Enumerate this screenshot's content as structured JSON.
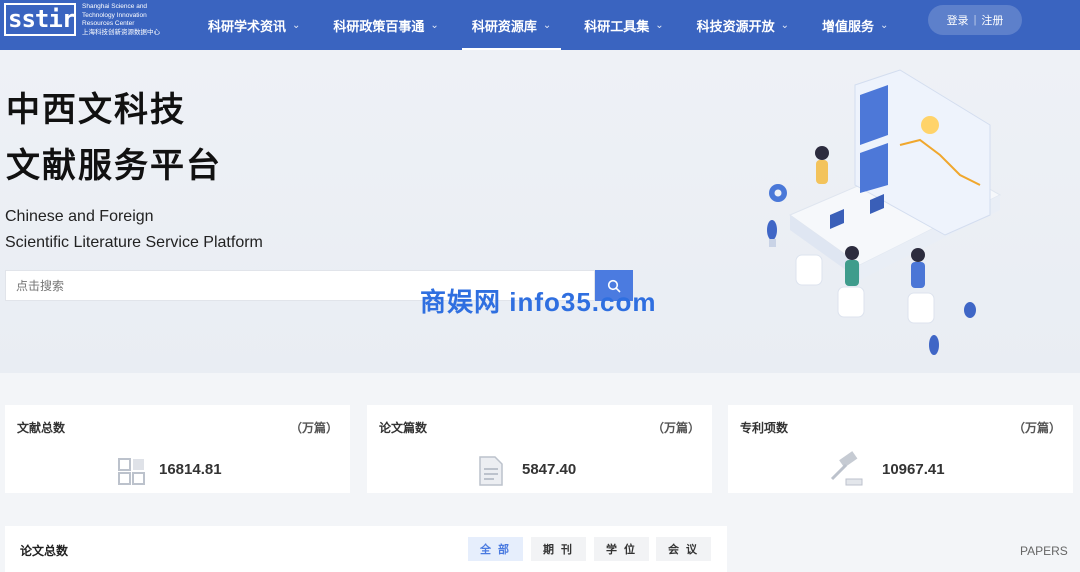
{
  "logo": {
    "mark": "sstir",
    "en_name": "Shanghai Science and Technology Innovation Resources Center",
    "cn_name": "上海科技创新资源数据中心"
  },
  "nav": {
    "items": [
      {
        "label": "科研学术资讯"
      },
      {
        "label": "科研政策百事通"
      },
      {
        "label": "科研资源库"
      },
      {
        "label": "科研工具集"
      },
      {
        "label": "科技资源开放"
      },
      {
        "label": "增值服务"
      }
    ],
    "active_index": 2,
    "login": "登录",
    "register": "注册"
  },
  "hero": {
    "title_line1": "中西文科技",
    "title_line2": "文献服务平台",
    "sub_line1": "Chinese and Foreign",
    "sub_line2": "Scientific Literature Service Platform",
    "search_placeholder": "点击搜索",
    "watermark": "商娱网 info35.com"
  },
  "stats": [
    {
      "label": "文献总数",
      "unit": "（万篇）",
      "value": "16814.81",
      "icon": "grid-icon"
    },
    {
      "label": "论文篇数",
      "unit": "（万篇）",
      "value": "5847.40",
      "icon": "document-icon"
    },
    {
      "label": "专利项数",
      "unit": "（万篇）",
      "value": "10967.41",
      "icon": "gavel-icon"
    }
  ],
  "papers": {
    "title": "论文总数",
    "filters": [
      "全 部",
      "期 刊",
      "学 位",
      "会 议"
    ],
    "active_filter": 0,
    "caption": "PAPERS"
  },
  "colors": {
    "nav_bg": "#3a64c0",
    "accent": "#4b7be0",
    "page_bg": "#f3f5f8"
  }
}
